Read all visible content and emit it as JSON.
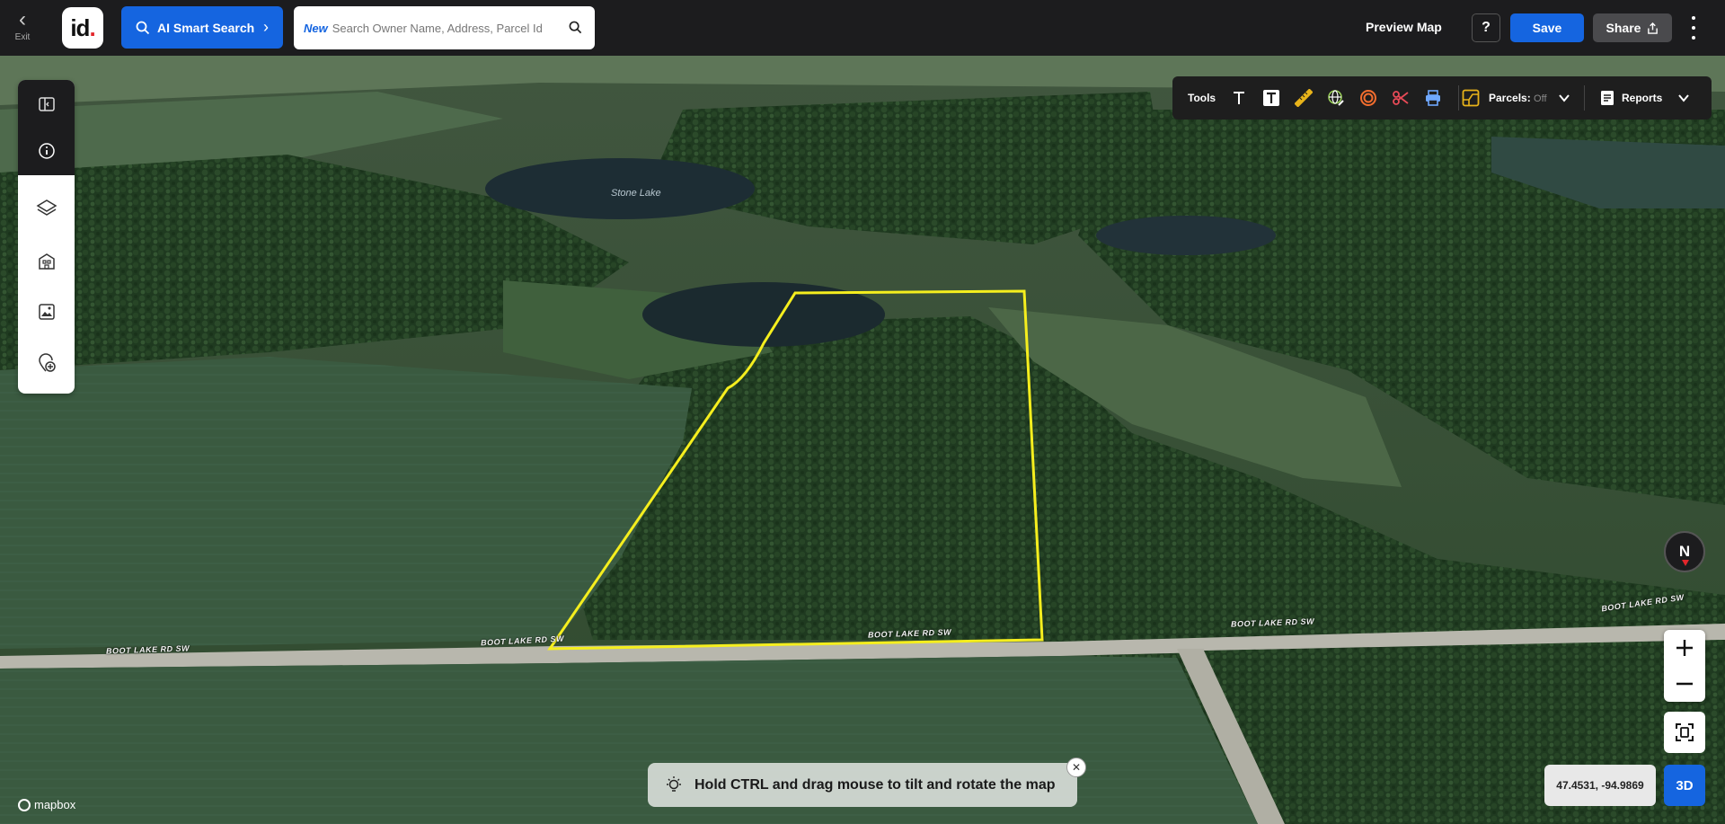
{
  "topbar": {
    "exit_label": "Exit",
    "logo_text": "id",
    "ai_search_label": "AI Smart Search",
    "search_new_badge": "New",
    "search_placeholder": "Search Owner Name, Address, Parcel Id",
    "preview_map_label": "Preview Map",
    "help_label": "?",
    "save_label": "Save",
    "share_label": "Share"
  },
  "sidebar": {
    "items": [
      {
        "icon": "collapse-panel-icon"
      },
      {
        "icon": "info-icon"
      },
      {
        "icon": "layers-icon"
      },
      {
        "icon": "buildings-icon"
      },
      {
        "icon": "image-gallery-icon"
      },
      {
        "icon": "add-location-icon"
      }
    ]
  },
  "toolbar": {
    "tools_label": "Tools",
    "icons": [
      "text-icon",
      "text-box-icon",
      "ruler-icon",
      "globe-edit-icon",
      "buffer-rings-icon",
      "scissors-icon",
      "print-icon"
    ],
    "parcels_label": "Parcels:",
    "parcels_state": "Off",
    "reports_label": "Reports"
  },
  "map": {
    "lake_label": "Stone Lake",
    "road_labels": [
      "BOOT LAKE RD SW",
      "BOOT LAKE RD SW",
      "BOOT LAKE RD SW",
      "BOOT LAKE RD SW",
      "BOOT LAKE RD SW"
    ],
    "parcel_outline_color": "#f5ee1e",
    "compass_label": "N",
    "coordinates": "47.4531, -94.9869",
    "mode_3d_label": "3D",
    "hint_text": "Hold CTRL and drag mouse to tilt and rotate the map",
    "attribution": "mapbox"
  },
  "colors": {
    "accent": "#1565e0",
    "topbar_bg": "#1c1c1e"
  }
}
